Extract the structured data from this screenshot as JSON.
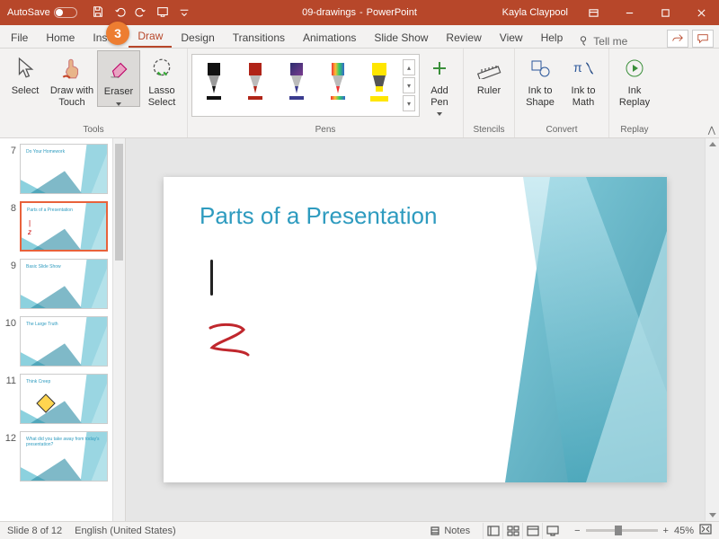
{
  "titlebar": {
    "autosave": "AutoSave",
    "doc": "09-drawings",
    "app": "PowerPoint",
    "user": "Kayla Claypool"
  },
  "tabs": {
    "file": "File",
    "home": "Home",
    "insert": "Insert",
    "draw": "Draw",
    "design": "Design",
    "transitions": "Transitions",
    "animations": "Animations",
    "slideshow": "Slide Show",
    "review": "Review",
    "view": "View",
    "help": "Help",
    "tell": "Tell me"
  },
  "ribbon": {
    "tools": {
      "label": "Tools",
      "select": "Select",
      "draw_touch": "Draw with\nTouch",
      "eraser": "Eraser",
      "lasso": "Lasso\nSelect"
    },
    "pens": {
      "label": "Pens",
      "add_pen": "Add\nPen"
    },
    "stencils": {
      "label": "Stencils",
      "ruler": "Ruler"
    },
    "convert": {
      "label": "Convert",
      "ink_shape": "Ink to\nShape",
      "ink_math": "Ink to\nMath"
    },
    "replay": {
      "label": "Replay",
      "ink_replay": "Ink\nReplay"
    }
  },
  "callout": "3",
  "thumbs": [
    {
      "num": "7",
      "title": "Do Your Homework"
    },
    {
      "num": "8",
      "title": "Parts of a Presentation",
      "selected": true,
      "ink": true
    },
    {
      "num": "9",
      "title": "Basic Slide Show"
    },
    {
      "num": "10",
      "title": "The Large Truth"
    },
    {
      "num": "11",
      "title": "Think Creep",
      "sign": true
    },
    {
      "num": "12",
      "title": "What did you take away from today's presentation?"
    }
  ],
  "slide": {
    "title": "Parts of a Presentation"
  },
  "status": {
    "slide": "Slide 8 of 12",
    "lang": "English (United States)",
    "notes": "Notes",
    "zoom": "45%"
  }
}
